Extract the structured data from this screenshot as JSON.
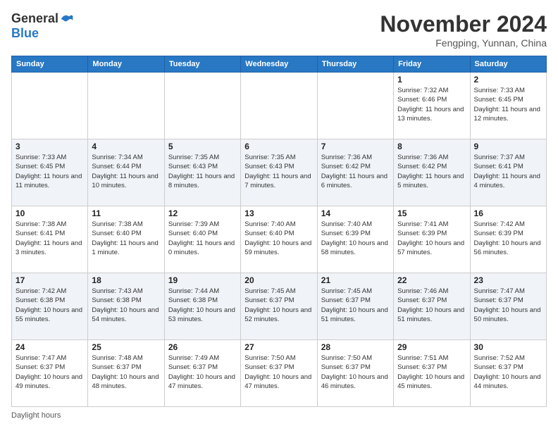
{
  "header": {
    "logo_general": "General",
    "logo_blue": "Blue",
    "month_title": "November 2024",
    "location": "Fengping, Yunnan, China"
  },
  "weekdays": [
    "Sunday",
    "Monday",
    "Tuesday",
    "Wednesday",
    "Thursday",
    "Friday",
    "Saturday"
  ],
  "footer": {
    "daylight_label": "Daylight hours"
  },
  "weeks": [
    {
      "days": [
        {
          "num": "",
          "info": ""
        },
        {
          "num": "",
          "info": ""
        },
        {
          "num": "",
          "info": ""
        },
        {
          "num": "",
          "info": ""
        },
        {
          "num": "",
          "info": ""
        },
        {
          "num": "1",
          "info": "Sunrise: 7:32 AM\nSunset: 6:46 PM\nDaylight: 11 hours and 13 minutes."
        },
        {
          "num": "2",
          "info": "Sunrise: 7:33 AM\nSunset: 6:45 PM\nDaylight: 11 hours and 12 minutes."
        }
      ]
    },
    {
      "days": [
        {
          "num": "3",
          "info": "Sunrise: 7:33 AM\nSunset: 6:45 PM\nDaylight: 11 hours and 11 minutes."
        },
        {
          "num": "4",
          "info": "Sunrise: 7:34 AM\nSunset: 6:44 PM\nDaylight: 11 hours and 10 minutes."
        },
        {
          "num": "5",
          "info": "Sunrise: 7:35 AM\nSunset: 6:43 PM\nDaylight: 11 hours and 8 minutes."
        },
        {
          "num": "6",
          "info": "Sunrise: 7:35 AM\nSunset: 6:43 PM\nDaylight: 11 hours and 7 minutes."
        },
        {
          "num": "7",
          "info": "Sunrise: 7:36 AM\nSunset: 6:42 PM\nDaylight: 11 hours and 6 minutes."
        },
        {
          "num": "8",
          "info": "Sunrise: 7:36 AM\nSunset: 6:42 PM\nDaylight: 11 hours and 5 minutes."
        },
        {
          "num": "9",
          "info": "Sunrise: 7:37 AM\nSunset: 6:41 PM\nDaylight: 11 hours and 4 minutes."
        }
      ]
    },
    {
      "days": [
        {
          "num": "10",
          "info": "Sunrise: 7:38 AM\nSunset: 6:41 PM\nDaylight: 11 hours and 3 minutes."
        },
        {
          "num": "11",
          "info": "Sunrise: 7:38 AM\nSunset: 6:40 PM\nDaylight: 11 hours and 1 minute."
        },
        {
          "num": "12",
          "info": "Sunrise: 7:39 AM\nSunset: 6:40 PM\nDaylight: 11 hours and 0 minutes."
        },
        {
          "num": "13",
          "info": "Sunrise: 7:40 AM\nSunset: 6:40 PM\nDaylight: 10 hours and 59 minutes."
        },
        {
          "num": "14",
          "info": "Sunrise: 7:40 AM\nSunset: 6:39 PM\nDaylight: 10 hours and 58 minutes."
        },
        {
          "num": "15",
          "info": "Sunrise: 7:41 AM\nSunset: 6:39 PM\nDaylight: 10 hours and 57 minutes."
        },
        {
          "num": "16",
          "info": "Sunrise: 7:42 AM\nSunset: 6:39 PM\nDaylight: 10 hours and 56 minutes."
        }
      ]
    },
    {
      "days": [
        {
          "num": "17",
          "info": "Sunrise: 7:42 AM\nSunset: 6:38 PM\nDaylight: 10 hours and 55 minutes."
        },
        {
          "num": "18",
          "info": "Sunrise: 7:43 AM\nSunset: 6:38 PM\nDaylight: 10 hours and 54 minutes."
        },
        {
          "num": "19",
          "info": "Sunrise: 7:44 AM\nSunset: 6:38 PM\nDaylight: 10 hours and 53 minutes."
        },
        {
          "num": "20",
          "info": "Sunrise: 7:45 AM\nSunset: 6:37 PM\nDaylight: 10 hours and 52 minutes."
        },
        {
          "num": "21",
          "info": "Sunrise: 7:45 AM\nSunset: 6:37 PM\nDaylight: 10 hours and 51 minutes."
        },
        {
          "num": "22",
          "info": "Sunrise: 7:46 AM\nSunset: 6:37 PM\nDaylight: 10 hours and 51 minutes."
        },
        {
          "num": "23",
          "info": "Sunrise: 7:47 AM\nSunset: 6:37 PM\nDaylight: 10 hours and 50 minutes."
        }
      ]
    },
    {
      "days": [
        {
          "num": "24",
          "info": "Sunrise: 7:47 AM\nSunset: 6:37 PM\nDaylight: 10 hours and 49 minutes."
        },
        {
          "num": "25",
          "info": "Sunrise: 7:48 AM\nSunset: 6:37 PM\nDaylight: 10 hours and 48 minutes."
        },
        {
          "num": "26",
          "info": "Sunrise: 7:49 AM\nSunset: 6:37 PM\nDaylight: 10 hours and 47 minutes."
        },
        {
          "num": "27",
          "info": "Sunrise: 7:50 AM\nSunset: 6:37 PM\nDaylight: 10 hours and 47 minutes."
        },
        {
          "num": "28",
          "info": "Sunrise: 7:50 AM\nSunset: 6:37 PM\nDaylight: 10 hours and 46 minutes."
        },
        {
          "num": "29",
          "info": "Sunrise: 7:51 AM\nSunset: 6:37 PM\nDaylight: 10 hours and 45 minutes."
        },
        {
          "num": "30",
          "info": "Sunrise: 7:52 AM\nSunset: 6:37 PM\nDaylight: 10 hours and 44 minutes."
        }
      ]
    }
  ]
}
